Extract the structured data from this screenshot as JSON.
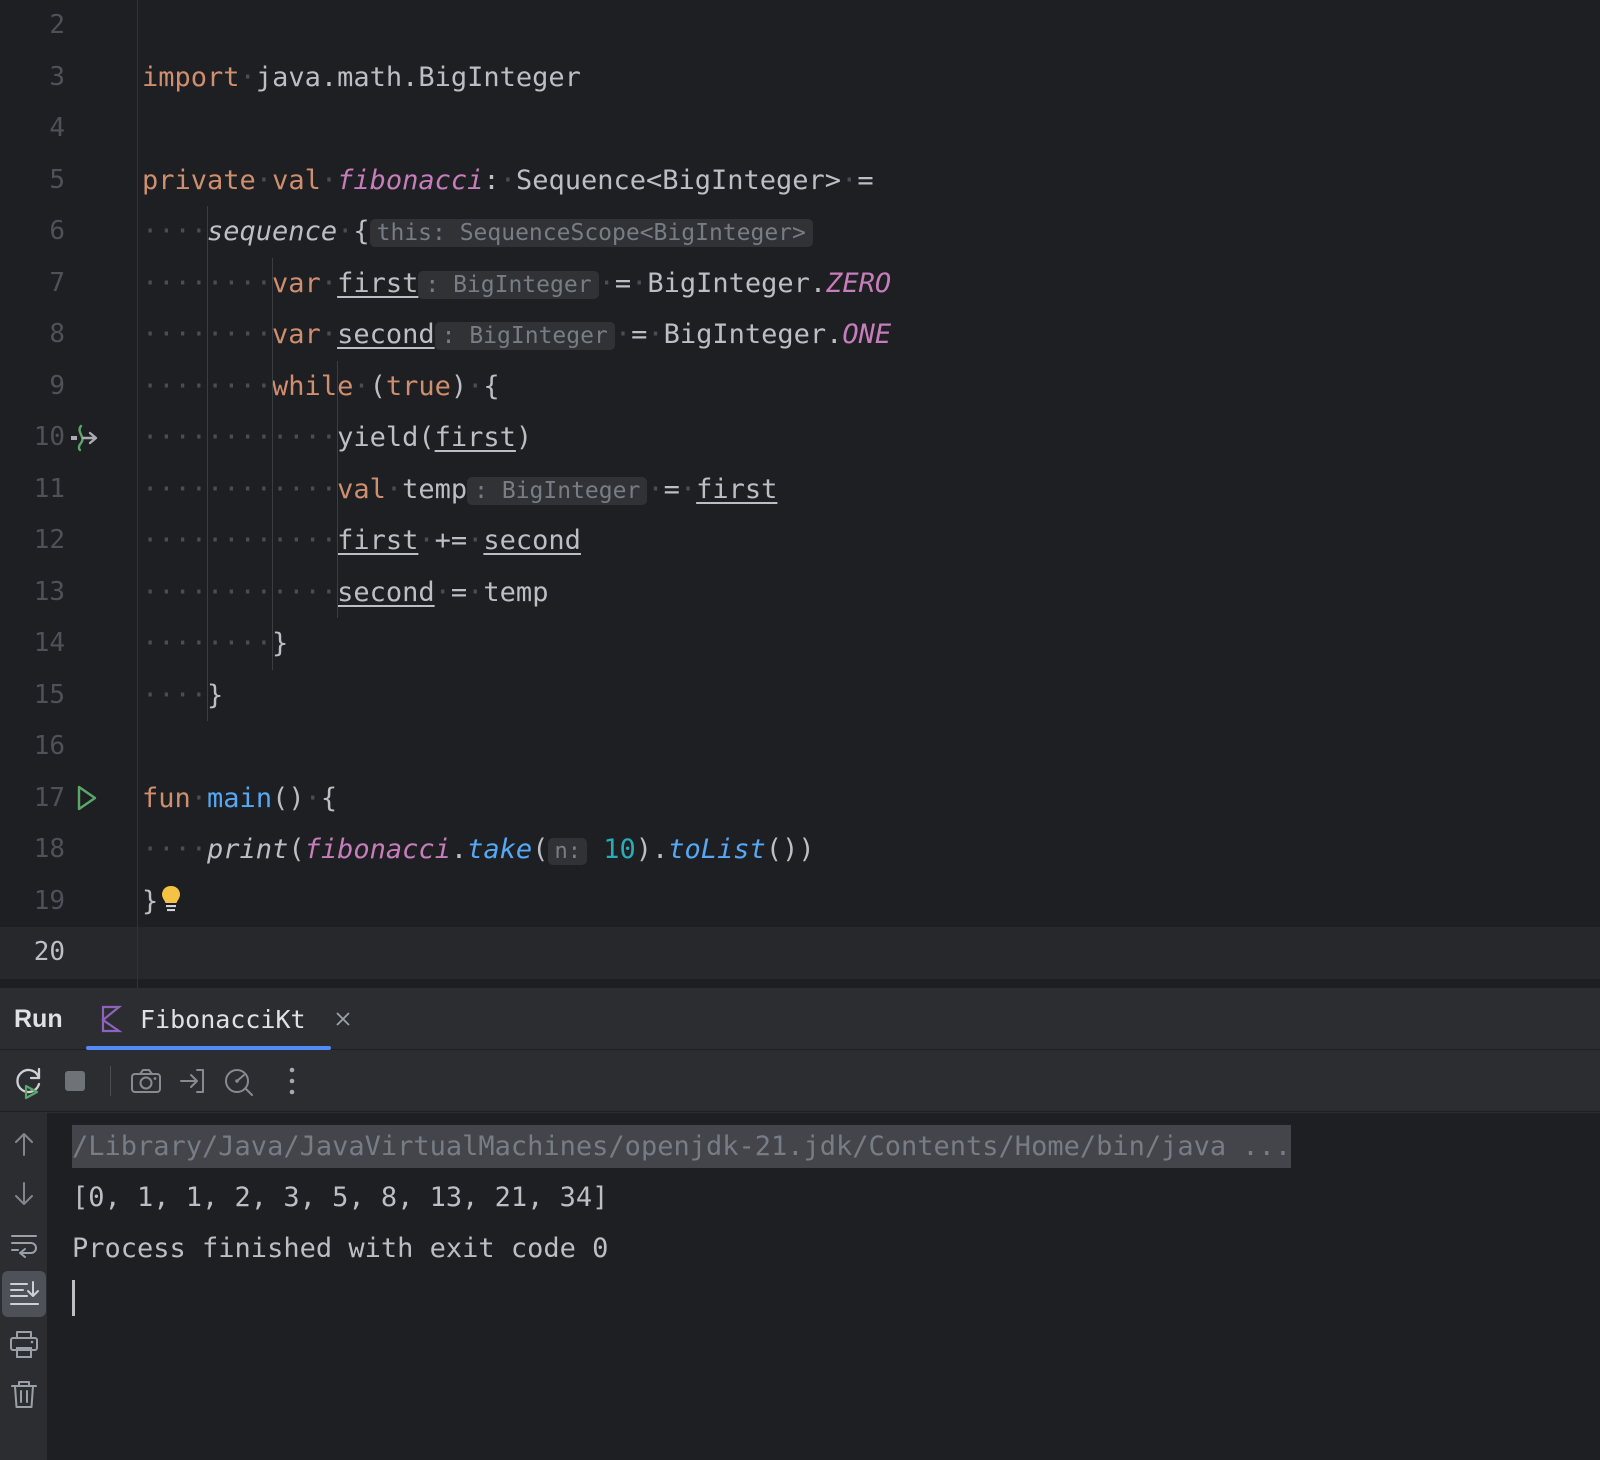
{
  "editor": {
    "first_visible_line": 2,
    "current_line": 20,
    "lines": [
      {
        "num": 2,
        "gutter": "",
        "tokens": []
      },
      {
        "num": 3,
        "gutter": "",
        "tokens": [
          {
            "t": "import",
            "c": "kw"
          },
          {
            "t": "·",
            "c": "ws"
          },
          {
            "t": "java.math.BigInteger",
            "c": "pln"
          }
        ]
      },
      {
        "num": 4,
        "gutter": "",
        "tokens": []
      },
      {
        "num": 5,
        "gutter": "",
        "tokens": [
          {
            "t": "private",
            "c": "kw"
          },
          {
            "t": "·",
            "c": "ws"
          },
          {
            "t": "val",
            "c": "kw"
          },
          {
            "t": "·",
            "c": "ws"
          },
          {
            "t": "fibonacci",
            "c": "fld"
          },
          {
            "t": ":",
            "c": "pln"
          },
          {
            "t": "·",
            "c": "ws"
          },
          {
            "t": "Sequence<BigInteger>",
            "c": "pln"
          },
          {
            "t": "·",
            "c": "ws"
          },
          {
            "t": "=",
            "c": "pln"
          }
        ]
      },
      {
        "num": 6,
        "gutter": "",
        "tokens": [
          {
            "t": "····",
            "c": "ws"
          },
          {
            "t": "sequence",
            "c": "itl"
          },
          {
            "t": "·",
            "c": "ws"
          },
          {
            "t": "{",
            "c": "pln"
          },
          {
            "t": "this: SequenceScope<BigInteger>",
            "c": "hint"
          }
        ]
      },
      {
        "num": 7,
        "gutter": "",
        "tokens": [
          {
            "t": "········",
            "c": "ws"
          },
          {
            "t": "var",
            "c": "kw"
          },
          {
            "t": "·",
            "c": "ws"
          },
          {
            "t": "first",
            "c": "udl"
          },
          {
            "t": ": BigInteger",
            "c": "hint"
          },
          {
            "t": "·",
            "c": "ws"
          },
          {
            "t": "=",
            "c": "pln"
          },
          {
            "t": "·",
            "c": "ws"
          },
          {
            "t": "BigInteger.",
            "c": "pln"
          },
          {
            "t": "ZERO",
            "c": "fld"
          }
        ]
      },
      {
        "num": 8,
        "gutter": "",
        "tokens": [
          {
            "t": "········",
            "c": "ws"
          },
          {
            "t": "var",
            "c": "kw"
          },
          {
            "t": "·",
            "c": "ws"
          },
          {
            "t": "second",
            "c": "udl"
          },
          {
            "t": ": BigInteger",
            "c": "hint"
          },
          {
            "t": "·",
            "c": "ws"
          },
          {
            "t": "=",
            "c": "pln"
          },
          {
            "t": "·",
            "c": "ws"
          },
          {
            "t": "BigInteger.",
            "c": "pln"
          },
          {
            "t": "ONE",
            "c": "fld"
          }
        ]
      },
      {
        "num": 9,
        "gutter": "",
        "tokens": [
          {
            "t": "········",
            "c": "ws"
          },
          {
            "t": "while",
            "c": "kw"
          },
          {
            "t": "·",
            "c": "ws"
          },
          {
            "t": "(",
            "c": "pln"
          },
          {
            "t": "true",
            "c": "kw"
          },
          {
            "t": ")",
            "c": "pln"
          },
          {
            "t": "·",
            "c": "ws"
          },
          {
            "t": "{",
            "c": "pln"
          }
        ]
      },
      {
        "num": 10,
        "gutter": "suspend-call-icon",
        "tokens": [
          {
            "t": "············",
            "c": "ws"
          },
          {
            "t": "yield(",
            "c": "pln"
          },
          {
            "t": "first",
            "c": "udl"
          },
          {
            "t": ")",
            "c": "pln"
          }
        ]
      },
      {
        "num": 11,
        "gutter": "",
        "tokens": [
          {
            "t": "············",
            "c": "ws"
          },
          {
            "t": "val",
            "c": "kw"
          },
          {
            "t": "·",
            "c": "ws"
          },
          {
            "t": "temp",
            "c": "pln"
          },
          {
            "t": ": BigInteger",
            "c": "hint"
          },
          {
            "t": "·",
            "c": "ws"
          },
          {
            "t": "=",
            "c": "pln"
          },
          {
            "t": "·",
            "c": "ws"
          },
          {
            "t": "first",
            "c": "udl"
          }
        ]
      },
      {
        "num": 12,
        "gutter": "",
        "tokens": [
          {
            "t": "············",
            "c": "ws"
          },
          {
            "t": "first",
            "c": "udl"
          },
          {
            "t": "·",
            "c": "ws"
          },
          {
            "t": "+=",
            "c": "pln"
          },
          {
            "t": "·",
            "c": "ws"
          },
          {
            "t": "second",
            "c": "udl"
          }
        ]
      },
      {
        "num": 13,
        "gutter": "",
        "tokens": [
          {
            "t": "············",
            "c": "ws"
          },
          {
            "t": "second",
            "c": "udl"
          },
          {
            "t": "·",
            "c": "ws"
          },
          {
            "t": "=",
            "c": "pln"
          },
          {
            "t": "·",
            "c": "ws"
          },
          {
            "t": "temp",
            "c": "pln"
          }
        ]
      },
      {
        "num": 14,
        "gutter": "",
        "tokens": [
          {
            "t": "········",
            "c": "ws"
          },
          {
            "t": "}",
            "c": "pln"
          }
        ]
      },
      {
        "num": 15,
        "gutter": "",
        "tokens": [
          {
            "t": "····",
            "c": "ws"
          },
          {
            "t": "}",
            "c": "pln"
          }
        ]
      },
      {
        "num": 16,
        "gutter": "",
        "tokens": []
      },
      {
        "num": 17,
        "gutter": "run-gutter-icon",
        "tokens": [
          {
            "t": "fun",
            "c": "kw"
          },
          {
            "t": "·",
            "c": "ws"
          },
          {
            "t": "main",
            "c": "fn"
          },
          {
            "t": "()",
            "c": "pln"
          },
          {
            "t": "·",
            "c": "ws"
          },
          {
            "t": "{",
            "c": "pln"
          }
        ]
      },
      {
        "num": 18,
        "gutter": "",
        "tokens": [
          {
            "t": "····",
            "c": "ws"
          },
          {
            "t": "print",
            "c": "itl"
          },
          {
            "t": "(",
            "c": "pln"
          },
          {
            "t": "fibonacci",
            "c": "fld"
          },
          {
            "t": ".",
            "c": "pln"
          },
          {
            "t": "take",
            "c": "fni"
          },
          {
            "t": "(",
            "c": "pln"
          },
          {
            "t": "n:",
            "c": "hint2"
          },
          {
            "t": " ",
            "c": "pln"
          },
          {
            "t": "10",
            "c": "num"
          },
          {
            "t": ")",
            "c": "pln"
          },
          {
            "t": ".",
            "c": "pln"
          },
          {
            "t": "toList",
            "c": "fni"
          },
          {
            "t": "())",
            "c": "pln"
          }
        ]
      },
      {
        "num": 19,
        "gutter": "",
        "tokens": [
          {
            "t": "}",
            "c": "pln"
          },
          {
            "t": "__BULB__",
            "c": "bulb"
          }
        ]
      },
      {
        "num": 20,
        "gutter": "",
        "tokens": []
      }
    ]
  },
  "run_panel": {
    "title": "Run",
    "tab": {
      "icon": "kotlin-file-icon",
      "label": "FibonacciKt",
      "close_icon": "close-icon"
    },
    "toolbar": [
      {
        "name": "rerun-button",
        "icon": "rerun-icon",
        "label": "Rerun"
      },
      {
        "name": "stop-button",
        "icon": "stop-icon",
        "label": "Stop"
      },
      {
        "name": "snapshot-button",
        "icon": "camera-icon",
        "label": "Capture Memory Snapshot"
      },
      {
        "name": "import-button",
        "icon": "import-icon",
        "label": "Import"
      },
      {
        "name": "profiler-button",
        "icon": "gauge-icon",
        "label": "Profiler"
      },
      {
        "name": "more-button",
        "icon": "more-vertical-icon",
        "label": "More"
      }
    ],
    "side_toolbar": [
      {
        "name": "scroll-up-button",
        "icon": "arrow-up-icon",
        "active": false
      },
      {
        "name": "scroll-down-button",
        "icon": "arrow-down-icon",
        "active": false
      },
      {
        "name": "soft-wrap-button",
        "icon": "soft-wrap-icon",
        "active": false
      },
      {
        "name": "scroll-to-end-button",
        "icon": "scroll-to-end-icon",
        "active": true
      },
      {
        "name": "print-button",
        "icon": "printer-icon",
        "active": false
      },
      {
        "name": "clear-all-button",
        "icon": "trash-icon",
        "active": false
      }
    ],
    "console": {
      "command_line": "/Library/Java/JavaVirtualMachines/openjdk-21.jdk/Contents/Home/bin/java ...",
      "output_line": "[0, 1, 1, 2, 3, 5, 8, 13, 21, 34]",
      "status_line": "Process finished with exit code 0"
    }
  },
  "colors": {
    "editor_bg": "#1e1f22",
    "panel_bg": "#2b2d30",
    "current_line": "#26282c",
    "accent_blue": "#548af7",
    "keyword_orange": "#cf8e6d",
    "field_pink": "#c77dbb",
    "function_blue": "#56a8f5",
    "number_teal": "#2aacb8",
    "text": "#bcbec4",
    "kotlin_purple": "#8f63bd",
    "run_green": "#59a869",
    "bulb_yellow": "#f5c344"
  }
}
